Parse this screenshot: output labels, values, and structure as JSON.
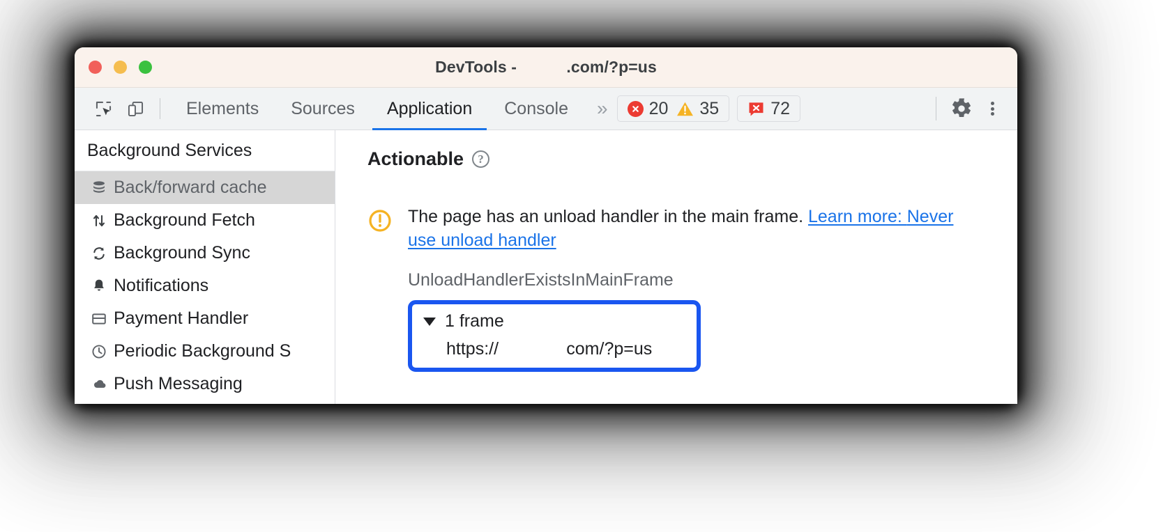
{
  "window": {
    "title": "DevTools -           .com/?p=us",
    "traffic_lights": [
      "close",
      "minimize",
      "maximize"
    ]
  },
  "toolbar": {
    "inspect_icon": "inspect-cursor-icon",
    "device_icon": "device-toolbar-icon",
    "tabs": [
      {
        "label": "Elements",
        "active": false
      },
      {
        "label": "Sources",
        "active": false
      },
      {
        "label": "Application",
        "active": true
      },
      {
        "label": "Console",
        "active": false
      }
    ],
    "more_tabs_label": "»",
    "counters": {
      "errors": "20",
      "warnings": "35",
      "issues": "72"
    },
    "settings_icon": "gear-icon",
    "menu_icon": "kebab-menu-icon"
  },
  "sidebar": {
    "header": "Background Services",
    "items": [
      {
        "label": "Back/forward cache",
        "icon": "database-icon",
        "selected": true
      },
      {
        "label": "Background Fetch",
        "icon": "up-down-arrows-icon",
        "selected": false
      },
      {
        "label": "Background Sync",
        "icon": "sync-refresh-icon",
        "selected": false
      },
      {
        "label": "Notifications",
        "icon": "bell-icon",
        "selected": false
      },
      {
        "label": "Payment Handler",
        "icon": "credit-card-icon",
        "selected": false
      },
      {
        "label": "Periodic Background S",
        "icon": "clock-icon",
        "selected": false
      },
      {
        "label": "Push Messaging",
        "icon": "cloud-icon",
        "selected": false
      }
    ]
  },
  "main": {
    "section_title": "Actionable",
    "help_glyph": "?",
    "warning_icon": "warning-exclamation-circle-icon",
    "reason_text": "The page has an unload handler in the main frame. ",
    "learn_more_prefix": "Learn more: ",
    "learn_more_link": "Never use unload handler",
    "reason_code": "UnloadHandlerExistsInMainFrame",
    "frames": {
      "toggle_label": "1 frame",
      "expanded": true,
      "url": "https://              com/?p=us"
    }
  },
  "colors": {
    "accent_blue": "#1a73e8",
    "highlight_blue": "#1a56f0",
    "error_red": "#ec3b32",
    "warning_yellow": "#f5b324",
    "titlebar_bg": "#faf2ec",
    "toolbar_bg": "#f1f3f4",
    "selected_row": "#d6d6d6"
  }
}
